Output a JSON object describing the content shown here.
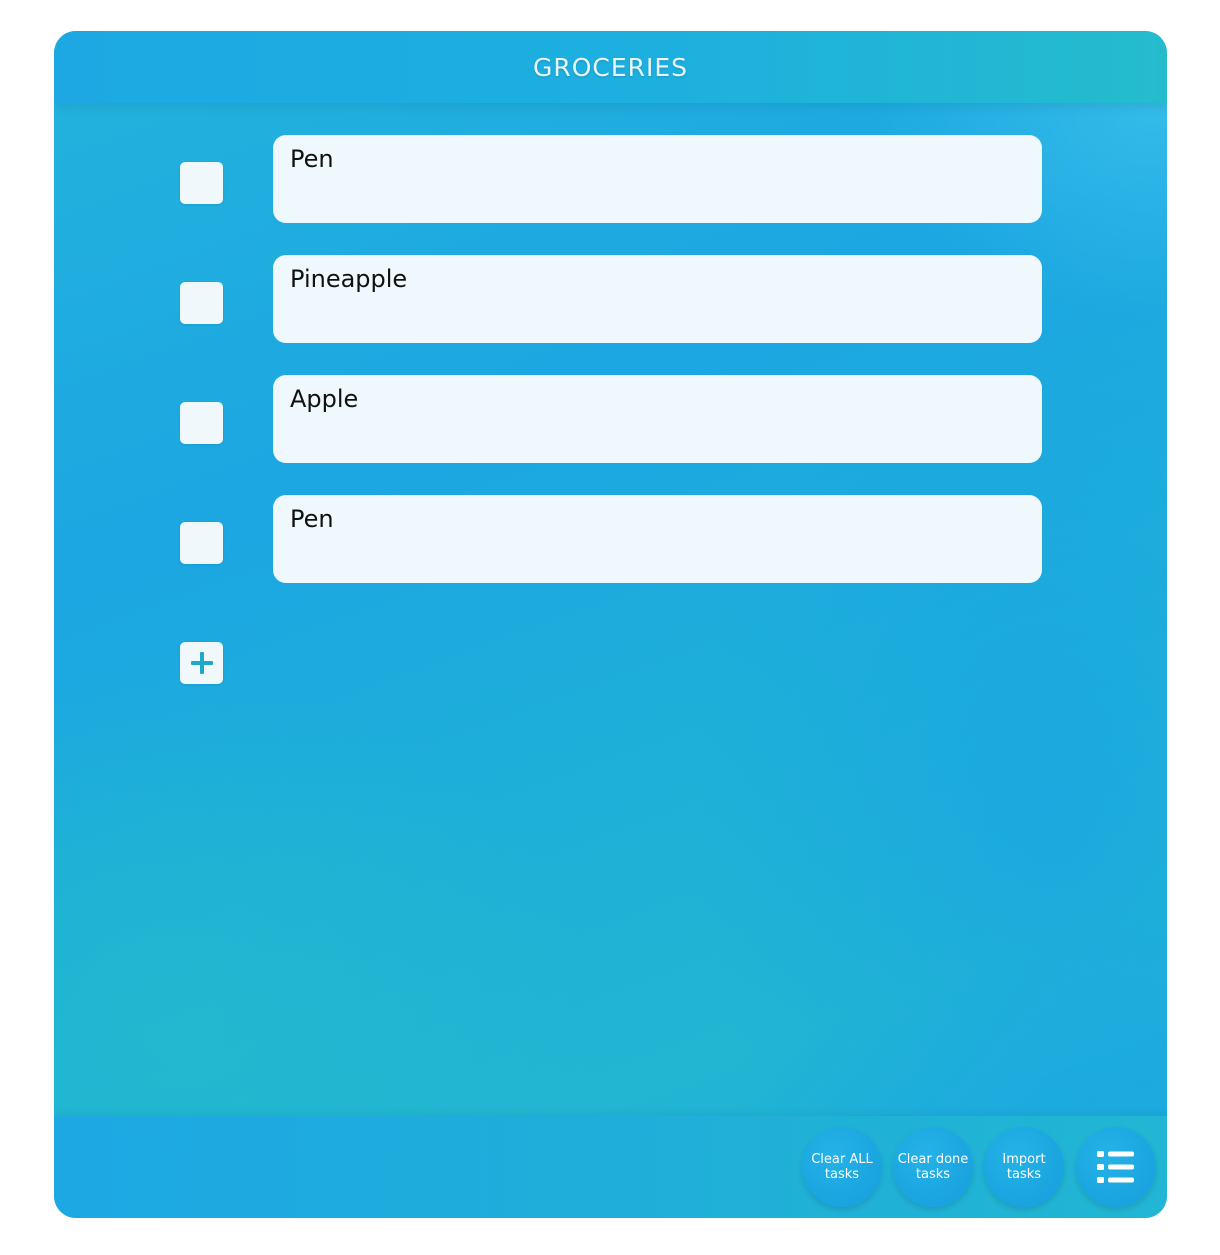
{
  "header": {
    "title": "GROCERIES"
  },
  "tasks": [
    {
      "text": "Pen",
      "done": false
    },
    {
      "text": "Pineapple",
      "done": false
    },
    {
      "text": "Apple",
      "done": false
    },
    {
      "text": "Pen",
      "done": false
    }
  ],
  "add_button": {
    "icon": "plus-icon"
  },
  "footer": {
    "clear_all": {
      "line1": "Clear ALL",
      "line2": "tasks"
    },
    "clear_done": {
      "line1": "Clear done",
      "line2": "tasks"
    },
    "import": {
      "line1": "Import",
      "line2": "tasks"
    },
    "menu": {
      "icon": "list-menu-icon"
    }
  },
  "colors": {
    "accent": "#1da8e3",
    "item_background": "#eff8fd",
    "plus": "#1fa9c9"
  }
}
